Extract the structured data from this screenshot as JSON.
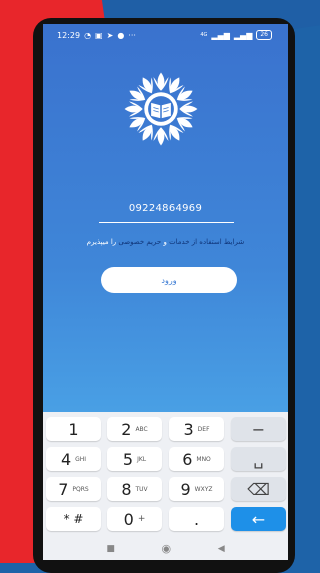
{
  "status_bar": {
    "time": "12:29",
    "left_icons": [
      "alarm-icon",
      "sim-icon",
      "telegram-icon",
      "app-icon"
    ],
    "more": "···",
    "signal_label": "4G",
    "battery": "26"
  },
  "login": {
    "phone_number": "09224864969",
    "terms_prefix": "شرایط استفاده از خدمات",
    "terms_and": "و",
    "terms_privacy": "حریم خصوصی",
    "terms_suffix": "را میپذیرم",
    "submit_label": "ورود"
  },
  "keypad": {
    "keys": [
      {
        "digit": "1",
        "letters": ""
      },
      {
        "digit": "2",
        "letters": "ABC"
      },
      {
        "digit": "3",
        "letters": "DEF"
      },
      {
        "digit": "−",
        "letters": ""
      },
      {
        "digit": "4",
        "letters": "GHI"
      },
      {
        "digit": "5",
        "letters": "JKL"
      },
      {
        "digit": "6",
        "letters": "MNO"
      },
      {
        "digit": "␣",
        "letters": ""
      },
      {
        "digit": "7",
        "letters": "PQRS"
      },
      {
        "digit": "8",
        "letters": "TUV"
      },
      {
        "digit": "9",
        "letters": "WXYZ"
      },
      {
        "digit": "⌫",
        "letters": ""
      },
      {
        "digit": "* #",
        "letters": ""
      },
      {
        "digit": "0",
        "letters": "+"
      },
      {
        "digit": ".",
        "letters": ""
      },
      {
        "digit": "←",
        "letters": ""
      }
    ]
  },
  "nav_bar": {
    "recent": "■",
    "home": "◉",
    "back": "◀"
  },
  "colors": {
    "accent": "#1e90e8",
    "background_top": "#3a72ce",
    "background_bottom": "#5ab6ee",
    "terms_link": "#10367a"
  }
}
